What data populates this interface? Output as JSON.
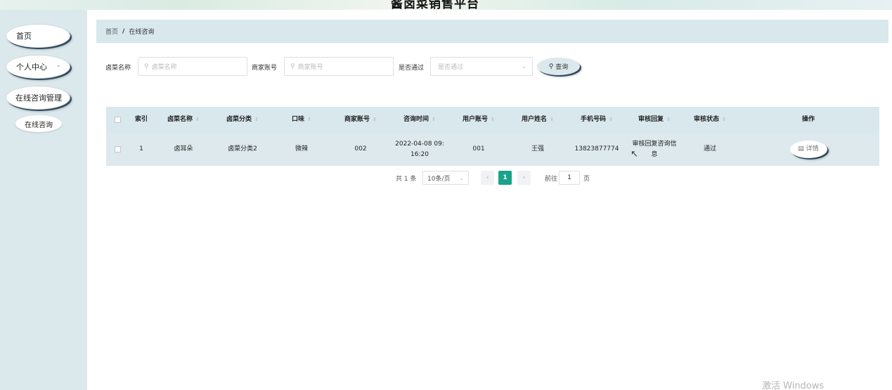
{
  "app": {
    "title": "酱卤菜销售平台"
  },
  "sidebar": {
    "items": [
      {
        "label": "首页"
      },
      {
        "label": "个人中心"
      },
      {
        "label": "在线咨询管理"
      }
    ],
    "submenu": [
      {
        "label": "在线咨询"
      }
    ]
  },
  "breadcrumb": {
    "home": "首页",
    "separator": "/",
    "current": "在线咨询"
  },
  "search": {
    "name_label": "卤菜名称",
    "name_placeholder": "卤菜名称",
    "merchant_label": "商家账号",
    "merchant_placeholder": "商家账号",
    "passed_label": "是否通过",
    "passed_placeholder": "是否通过",
    "query_label": "查询"
  },
  "table": {
    "columns": [
      "索引",
      "卤菜名称",
      "卤菜分类",
      "口味",
      "商家账号",
      "咨询时间",
      "用户账号",
      "用户姓名",
      "手机号码",
      "审核回复",
      "审核状态",
      "操作"
    ],
    "rows": [
      {
        "index": "1",
        "name": "卤耳朵",
        "category": "卤菜分类2",
        "flavor": "微辣",
        "merchant": "002",
        "time_line1": "2022-04-08 09:",
        "time_line2": "16:20",
        "user_account": "001",
        "user_name": "王强",
        "phone": "13823877774",
        "reply_line1": "审核回复咨询信",
        "reply_line2": "息",
        "status": "通过",
        "action": "详情"
      }
    ]
  },
  "pagination": {
    "total": "共 1 条",
    "page_size": "10条/页",
    "current_page": "1",
    "goto_label": "前往",
    "goto_value": "1",
    "page_unit": "页"
  },
  "watermark": "激活 Windows",
  "colors": {
    "sidebar_bg": "#dbe9ed",
    "header_bg": "#d8e8ed",
    "accent": "#1aa28a",
    "button_shadow": "#34495e"
  }
}
